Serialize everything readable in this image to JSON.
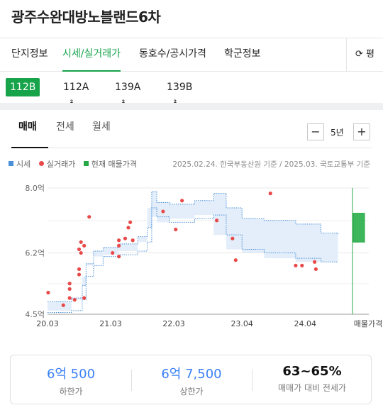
{
  "title": "광주수완대방노블랜드6차",
  "tabs": [
    {
      "label": "단지정보"
    },
    {
      "label": "시세/실거래가"
    },
    {
      "label": "동호수/공시가격"
    },
    {
      "label": "학군정보"
    }
  ],
  "pyeong_label": "⟳ 평",
  "area_chips": [
    "112B㎡",
    "112A㎡",
    "139A㎡",
    "139B㎡"
  ],
  "subtabs": [
    "매매",
    "전세",
    "월세"
  ],
  "period": {
    "label": "5년",
    "minus": "−",
    "plus": "+"
  },
  "legend": [
    {
      "label": "시세",
      "color": "#4a90d9"
    },
    {
      "label": "실거래가",
      "color": "#e84a4a"
    },
    {
      "label": "현재 매물가격",
      "color": "#27a844"
    }
  ],
  "source_text": "2025.02.24. 한국부동산원 기준 / 2025.03. 국토교통부 기준",
  "chart_data": {
    "type": "line",
    "y_tick_labels": [
      "8.0억",
      "6.2억",
      "4.5억"
    ],
    "y_ticks": [
      8.0,
      6.2,
      4.5
    ],
    "ylim": [
      4.5,
      8.0
    ],
    "x_tick_labels": [
      "20.03",
      "21.03",
      "22.03",
      "23.04",
      "24.04",
      "매물가격"
    ],
    "x_ticks": [
      2020.17,
      2021.17,
      2022.17,
      2023.25,
      2024.25
    ],
    "xlim": [
      2020.17,
      2025.0
    ],
    "series": [
      {
        "name": "시세",
        "upper": [
          [
            2020.17,
            4.85
          ],
          [
            2020.55,
            4.95
          ],
          [
            2020.72,
            5.3
          ],
          [
            2020.78,
            5.9
          ],
          [
            2020.9,
            6.25
          ],
          [
            2021.05,
            6.35
          ],
          [
            2021.3,
            6.45
          ],
          [
            2021.6,
            6.65
          ],
          [
            2021.75,
            6.9
          ],
          [
            2021.82,
            7.9
          ],
          [
            2021.9,
            7.6
          ],
          [
            2022.1,
            7.55
          ],
          [
            2022.5,
            7.65
          ],
          [
            2022.8,
            7.85
          ],
          [
            2023.0,
            7.45
          ],
          [
            2023.25,
            7.15
          ],
          [
            2023.6,
            7.1
          ],
          [
            2024.1,
            7.0
          ],
          [
            2024.5,
            6.75
          ],
          [
            2024.77,
            6.7
          ]
        ],
        "lower": [
          [
            2020.17,
            4.55
          ],
          [
            2020.55,
            4.6
          ],
          [
            2020.72,
            4.9
          ],
          [
            2020.78,
            5.55
          ],
          [
            2020.9,
            5.85
          ],
          [
            2021.05,
            6.1
          ],
          [
            2021.3,
            6.15
          ],
          [
            2021.6,
            6.25
          ],
          [
            2021.75,
            6.5
          ],
          [
            2021.82,
            7.45
          ],
          [
            2021.9,
            7.2
          ],
          [
            2022.1,
            7.05
          ],
          [
            2022.5,
            7.15
          ],
          [
            2022.8,
            7.25
          ],
          [
            2023.0,
            6.7
          ],
          [
            2023.25,
            6.3
          ],
          [
            2023.6,
            6.2
          ],
          [
            2024.1,
            6.05
          ],
          [
            2024.5,
            5.95
          ],
          [
            2024.77,
            5.95
          ]
        ]
      },
      {
        "name": "실거래가",
        "points": [
          [
            2020.18,
            5.1
          ],
          [
            2020.42,
            4.75
          ],
          [
            2020.52,
            5.2
          ],
          [
            2020.52,
            5.35
          ],
          [
            2020.52,
            4.95
          ],
          [
            2020.6,
            4.9
          ],
          [
            2020.67,
            5.6
          ],
          [
            2020.67,
            5.75
          ],
          [
            2020.67,
            6.3
          ],
          [
            2020.7,
            6.5
          ],
          [
            2020.7,
            6.2
          ],
          [
            2020.75,
            6.4
          ],
          [
            2020.75,
            4.95
          ],
          [
            2020.83,
            7.2
          ],
          [
            2021.2,
            6.2
          ],
          [
            2021.3,
            6.55
          ],
          [
            2021.3,
            6.4
          ],
          [
            2021.3,
            6.1
          ],
          [
            2021.4,
            6.6
          ],
          [
            2021.45,
            6.9
          ],
          [
            2021.48,
            7.05
          ],
          [
            2021.52,
            6.55
          ],
          [
            2022.0,
            7.35
          ],
          [
            2022.2,
            6.85
          ],
          [
            2022.3,
            7.65
          ],
          [
            2022.85,
            7.1
          ],
          [
            2023.1,
            6.6
          ],
          [
            2023.15,
            6.0
          ],
          [
            2023.7,
            7.85
          ],
          [
            2024.1,
            5.85
          ],
          [
            2024.2,
            5.85
          ],
          [
            2024.4,
            5.95
          ],
          [
            2024.42,
            5.75
          ]
        ]
      },
      {
        "name": "현재 매물가격",
        "range": [
          6.5,
          7.3
        ]
      }
    ]
  },
  "stats": [
    {
      "value": "6억 500",
      "label": "하한가"
    },
    {
      "value": "6억 7,500",
      "label": "상한가"
    },
    {
      "value": "63~65%",
      "label": "매매가 대비 전세가"
    }
  ]
}
